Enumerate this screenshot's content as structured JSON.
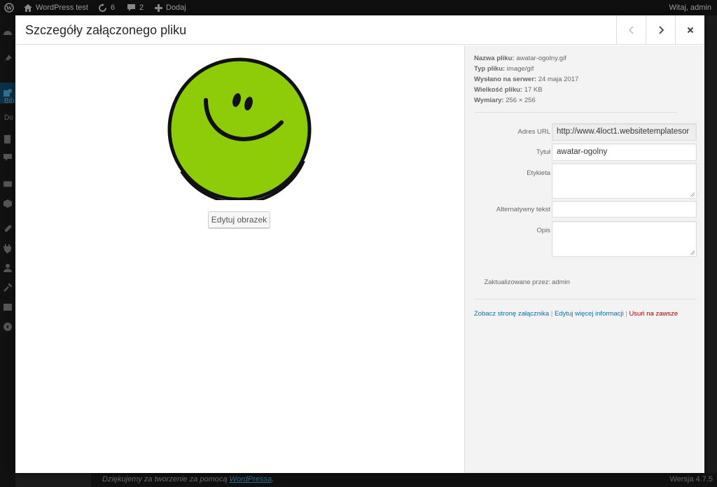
{
  "adminbar": {
    "site_name": "WordPress test",
    "updates_count": "6",
    "comments_count": "2",
    "new_label": "Dodaj",
    "greeting": "Witaj, admin"
  },
  "sidemenu": {
    "submenu_label_1": "Bib",
    "submenu_label_2": "Do"
  },
  "footer": {
    "thanks_prefix": "Dziękujemy za tworzenie za pomocą ",
    "thanks_link": "WordPressa",
    "thanks_suffix": ".",
    "version": "Wersja 4.7.5"
  },
  "modal": {
    "title": "Szczegóły załączonego pliku",
    "edit_image_label": "Edytuj obrazek",
    "meta": {
      "filename_label": "Nazwa pliku:",
      "filename": "awatar-ogolny.gif",
      "filetype_label": "Typ pliku:",
      "filetype": "image/gif",
      "uploaded_label": "Wysłano na serwer:",
      "uploaded": "24 maja 2017",
      "filesize_label": "Wielkość pliku:",
      "filesize": "17 KB",
      "dimensions_label": "Wymiary:",
      "dimensions": "256 × 256"
    },
    "fields": {
      "url_label": "Adres URL",
      "url_value": "http://www.4loct1.websitetemplatesor",
      "title_label": "Tytuł",
      "title_value": "awatar-ogolny",
      "caption_label": "Etykieta",
      "caption_value": "",
      "alt_label": "Alternatywny tekst",
      "alt_value": "",
      "desc_label": "Opis",
      "desc_value": "",
      "updated_by_label": "Zaktualizowane przez:",
      "updated_by_value": "admin"
    },
    "actions": {
      "view_label": "Zobacz stronę załącznika",
      "edit_more_label": "Edytuj więcej informacji",
      "delete_label": "Usuń na zawsze",
      "separator": "|"
    }
  },
  "colors": {
    "smiley_fill": "#8dcc06",
    "link": "#0073aa",
    "delete_link": "#a00000"
  }
}
